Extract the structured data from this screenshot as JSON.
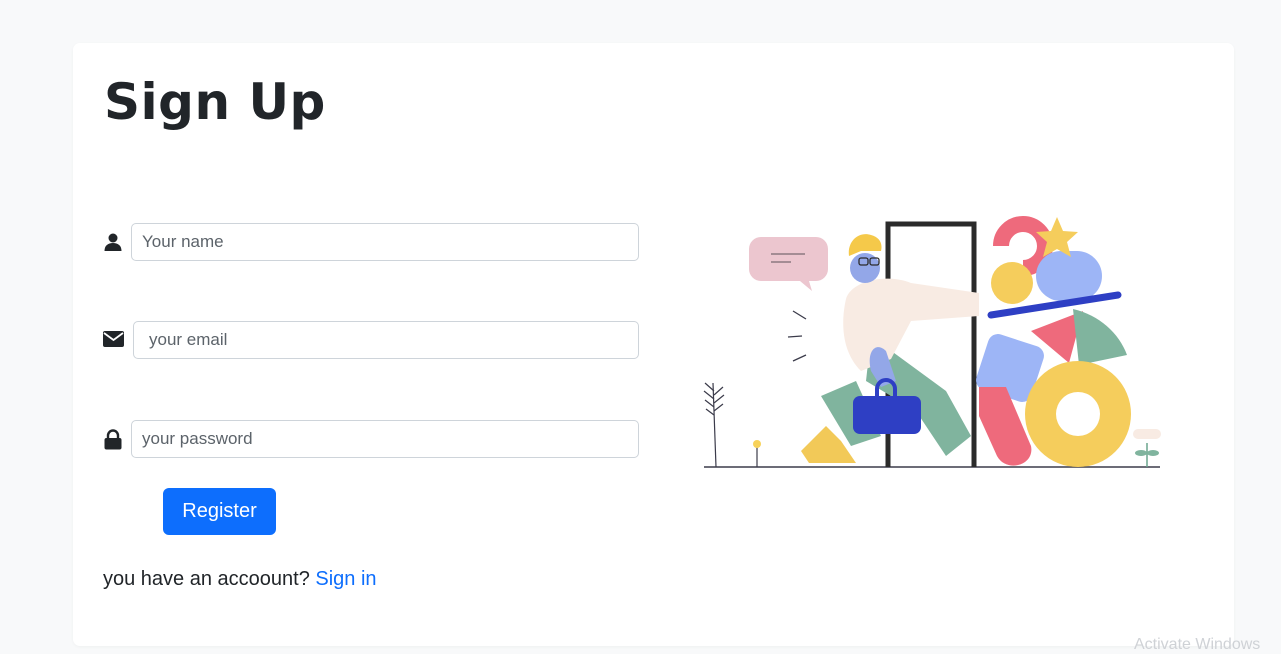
{
  "form": {
    "title": "Sign Up",
    "name_placeholder": "Your name",
    "email_placeholder": "your email",
    "password_placeholder": "your password",
    "register_label": "Register",
    "account_prompt": "you have an accoount?",
    "signin_label": "Sign in"
  },
  "icons": {
    "name": "user-icon",
    "email": "envelope-icon",
    "password": "lock-icon"
  },
  "colors": {
    "primary": "#0d6efd",
    "text": "#212529",
    "background": "#f8f9fa"
  },
  "watermark": "Activate Windows"
}
